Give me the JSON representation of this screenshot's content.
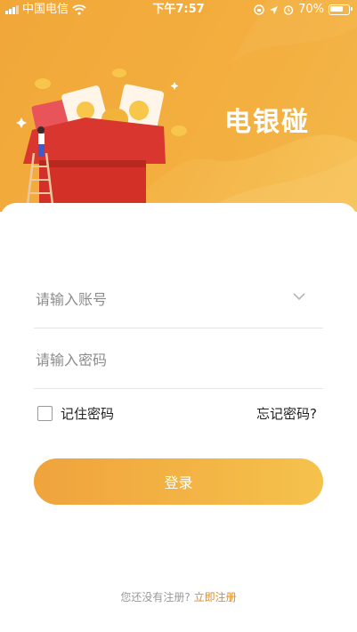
{
  "status_bar": {
    "carrier": "中国电信",
    "time": "下午7:57",
    "battery": "70%"
  },
  "header": {
    "app_name": "电银碰"
  },
  "form": {
    "account_placeholder": "请输入账号",
    "password_placeholder": "请输入密码",
    "remember_label": "记住密码",
    "forgot_label": "忘记密码?",
    "login_label": "登录"
  },
  "footer": {
    "question": "您还没有注册?",
    "register_link": "立即注册"
  },
  "colors": {
    "accent": "#f3ad42",
    "link": "#e08a24"
  },
  "icons": [
    "signal-icon",
    "wifi-icon",
    "lock-rotation-icon",
    "location-icon",
    "alarm-icon",
    "battery-icon",
    "chevron-down-icon",
    "checkbox-icon"
  ]
}
